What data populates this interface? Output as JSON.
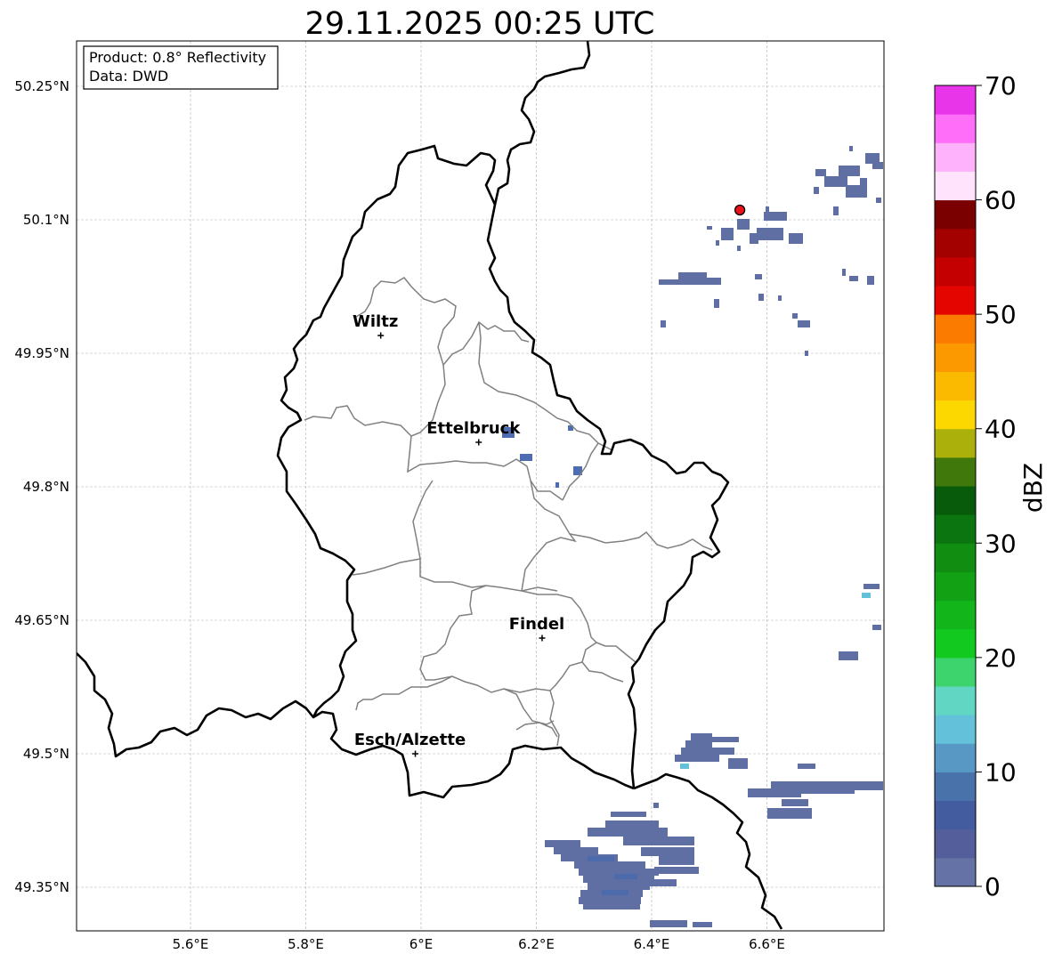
{
  "title": "29.11.2025 00:25 UTC",
  "info_box": {
    "product": "Product: 0.8° Reflectivity",
    "data": "Data: DWD"
  },
  "map": {
    "lon_range": [
      5.4,
      6.8
    ],
    "lat_range": [
      49.3,
      50.3
    ],
    "x_ticks": [
      {
        "value": 5.6,
        "label": "5.6°E"
      },
      {
        "value": 5.8,
        "label": "5.8°E"
      },
      {
        "value": 6.0,
        "label": "6°E"
      },
      {
        "value": 6.2,
        "label": "6.2°E"
      },
      {
        "value": 6.4,
        "label": "6.4°E"
      },
      {
        "value": 6.6,
        "label": "6.6°E"
      }
    ],
    "y_ticks": [
      {
        "value": 50.25,
        "label": "50.25°N"
      },
      {
        "value": 50.1,
        "label": "50.1°N"
      },
      {
        "value": 49.95,
        "label": "49.95°N"
      },
      {
        "value": 49.8,
        "label": "49.8°N"
      },
      {
        "value": 49.65,
        "label": "49.65°N"
      },
      {
        "value": 49.5,
        "label": "49.5°N"
      },
      {
        "value": 49.35,
        "label": "49.35°N"
      }
    ],
    "grid": true,
    "cities": [
      {
        "name": "Wiltz",
        "lon": 5.93,
        "lat": 49.97
      },
      {
        "name": "Ettelbruck",
        "lon": 6.1,
        "lat": 49.85
      },
      {
        "name": "Findel",
        "lon": 6.21,
        "lat": 49.63
      },
      {
        "name": "Esch/Alzette",
        "lon": 5.99,
        "lat": 49.5
      }
    ],
    "radar_site": {
      "lon": 6.55,
      "lat": 50.11,
      "color": "#e8131a"
    },
    "colors": {
      "national_border": "#000000",
      "canton_border": "#808080",
      "grid": "#b0b0b0"
    }
  },
  "colorbar": {
    "label": "dBZ",
    "min": 0,
    "max": 70,
    "step": 2.5,
    "tick_labels": [
      "0",
      "10",
      "20",
      "30",
      "40",
      "50",
      "60",
      "70"
    ],
    "colors": [
      "#6472a6",
      "#535e9b",
      "#435c9f",
      "#4a72aa",
      "#5799c4",
      "#64c1da",
      "#61d6c3",
      "#3dd46e",
      "#12c91f",
      "#12b51a",
      "#12a115",
      "#118d12",
      "#0b7510",
      "#075b0b",
      "#41780b",
      "#acb00a",
      "#fcd700",
      "#fbb900",
      "#fc9900",
      "#fb7a00",
      "#e40400",
      "#c40000",
      "#a30000",
      "#7a0000",
      "#ffe2fb",
      "#ffb2fc",
      "#ff6ef8",
      "#e935ea"
    ]
  }
}
